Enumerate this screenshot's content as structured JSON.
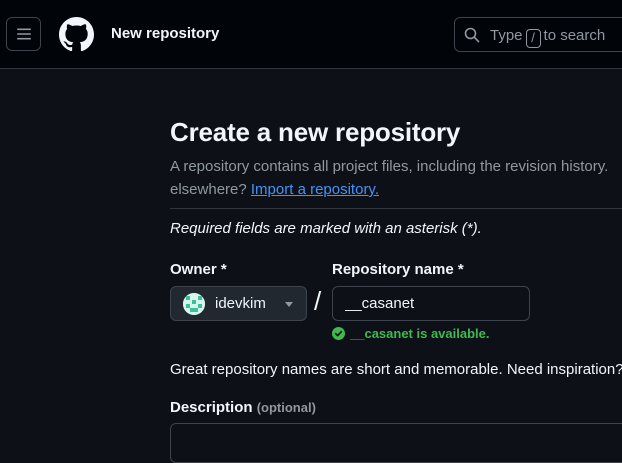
{
  "header": {
    "title": "New repository",
    "search": {
      "prefix": "Type",
      "key": "/",
      "suffix": "to search"
    }
  },
  "form": {
    "heading": "Create a new repository",
    "description_line1": "A repository contains all project files, including the revision history.",
    "description_line2_prefix": "elsewhere?",
    "import_link": "Import a repository.",
    "required_note": "Required fields are marked with an asterisk (*).",
    "owner_label": "Owner *",
    "owner_value": "idevkim",
    "slash": "/",
    "repo_name_label": "Repository name *",
    "repo_name_value": "__casanet",
    "availability": "__casanet is available.",
    "name_hint": "Great repository names are short and memorable. Need inspiration?",
    "description_label": "Description",
    "description_optional": "(optional)",
    "description_value": ""
  },
  "colors": {
    "background": "#0d1117",
    "header_background": "#010409",
    "link": "#4493f8",
    "success": "#3fb950"
  }
}
